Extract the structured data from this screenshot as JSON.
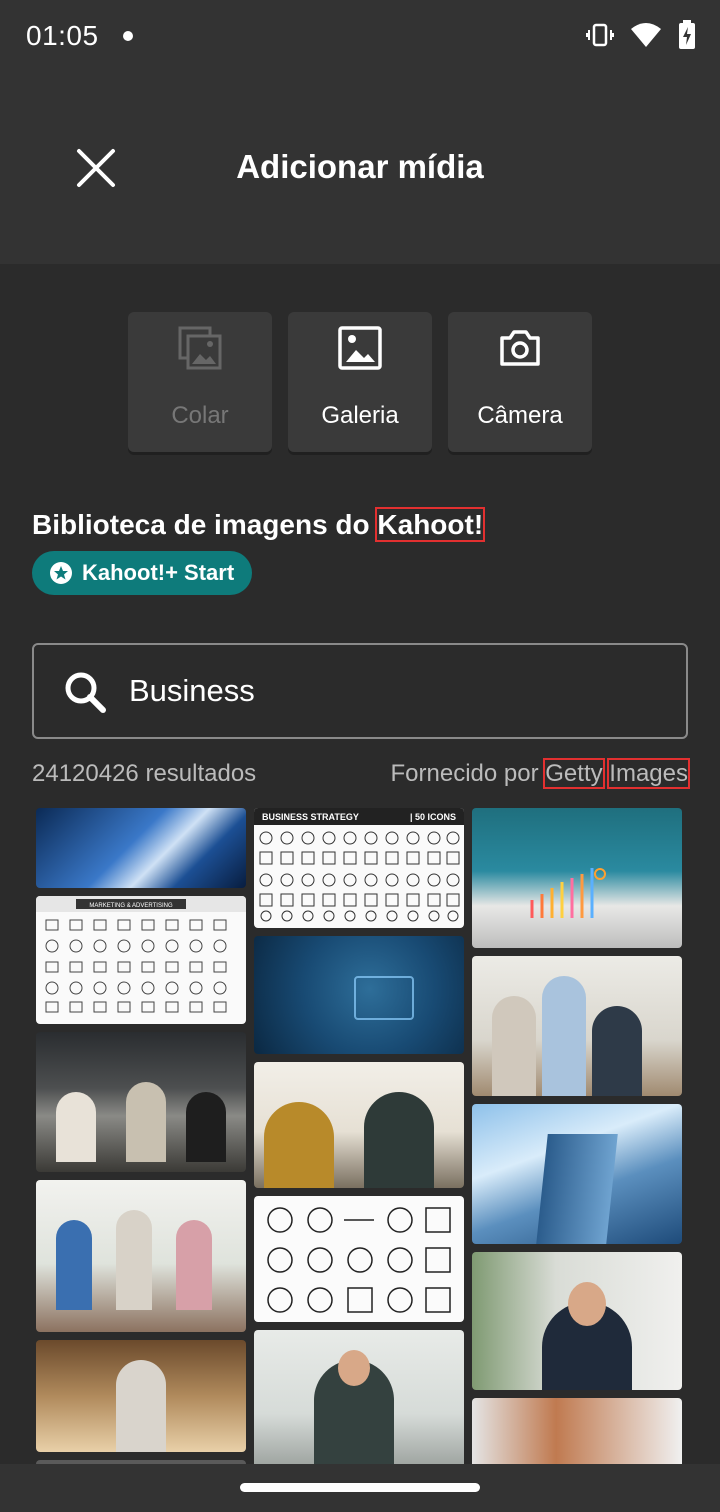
{
  "status_bar": {
    "time": "01:05"
  },
  "header": {
    "title": "Adicionar mídia"
  },
  "sources": [
    {
      "label": "Colar",
      "icon": "paste-image-icon",
      "enabled": false
    },
    {
      "label": "Galeria",
      "icon": "gallery-image-icon",
      "enabled": true
    },
    {
      "label": "Câmera",
      "icon": "camera-icon",
      "enabled": true
    }
  ],
  "library": {
    "title_prefix": "Biblioteca de imagens do ",
    "title_brand": "Kahoot!",
    "badge": "Kahoot!+ Start"
  },
  "search": {
    "value": "Business",
    "placeholder": ""
  },
  "results": {
    "count_text": "24120426 resultados",
    "provided_by": "Fornecido por ",
    "provider_word1": "Getty",
    "provider_word2": "Images"
  },
  "images": {
    "col1": [
      {
        "alt": "business handshake blue"
      },
      {
        "alt": "marketing and advertising icons",
        "text": "MARKETING & ADVERTISING"
      },
      {
        "alt": "office meeting"
      },
      {
        "alt": "team collaborating"
      },
      {
        "alt": "smiling businesswoman"
      },
      {
        "alt": "office team"
      }
    ],
    "col2": [
      {
        "alt": "business strategy icons",
        "text": "BUSINESS STRATEGY",
        "text2": "| 50 ICONS"
      },
      {
        "alt": "businessman checklist"
      },
      {
        "alt": "high five colleagues"
      },
      {
        "alt": "business line icons"
      },
      {
        "alt": "smiling businessman in office"
      }
    ],
    "col3": [
      {
        "alt": "laptop growth chart"
      },
      {
        "alt": "team at laptop"
      },
      {
        "alt": "glass skyscraper"
      },
      {
        "alt": "businessman with tablet"
      },
      {
        "alt": "handshake"
      }
    ]
  },
  "colors": {
    "accent": "#0e7b7b",
    "background": "#2b2b2b",
    "panel": "#333333",
    "button": "#3a3a3a"
  }
}
